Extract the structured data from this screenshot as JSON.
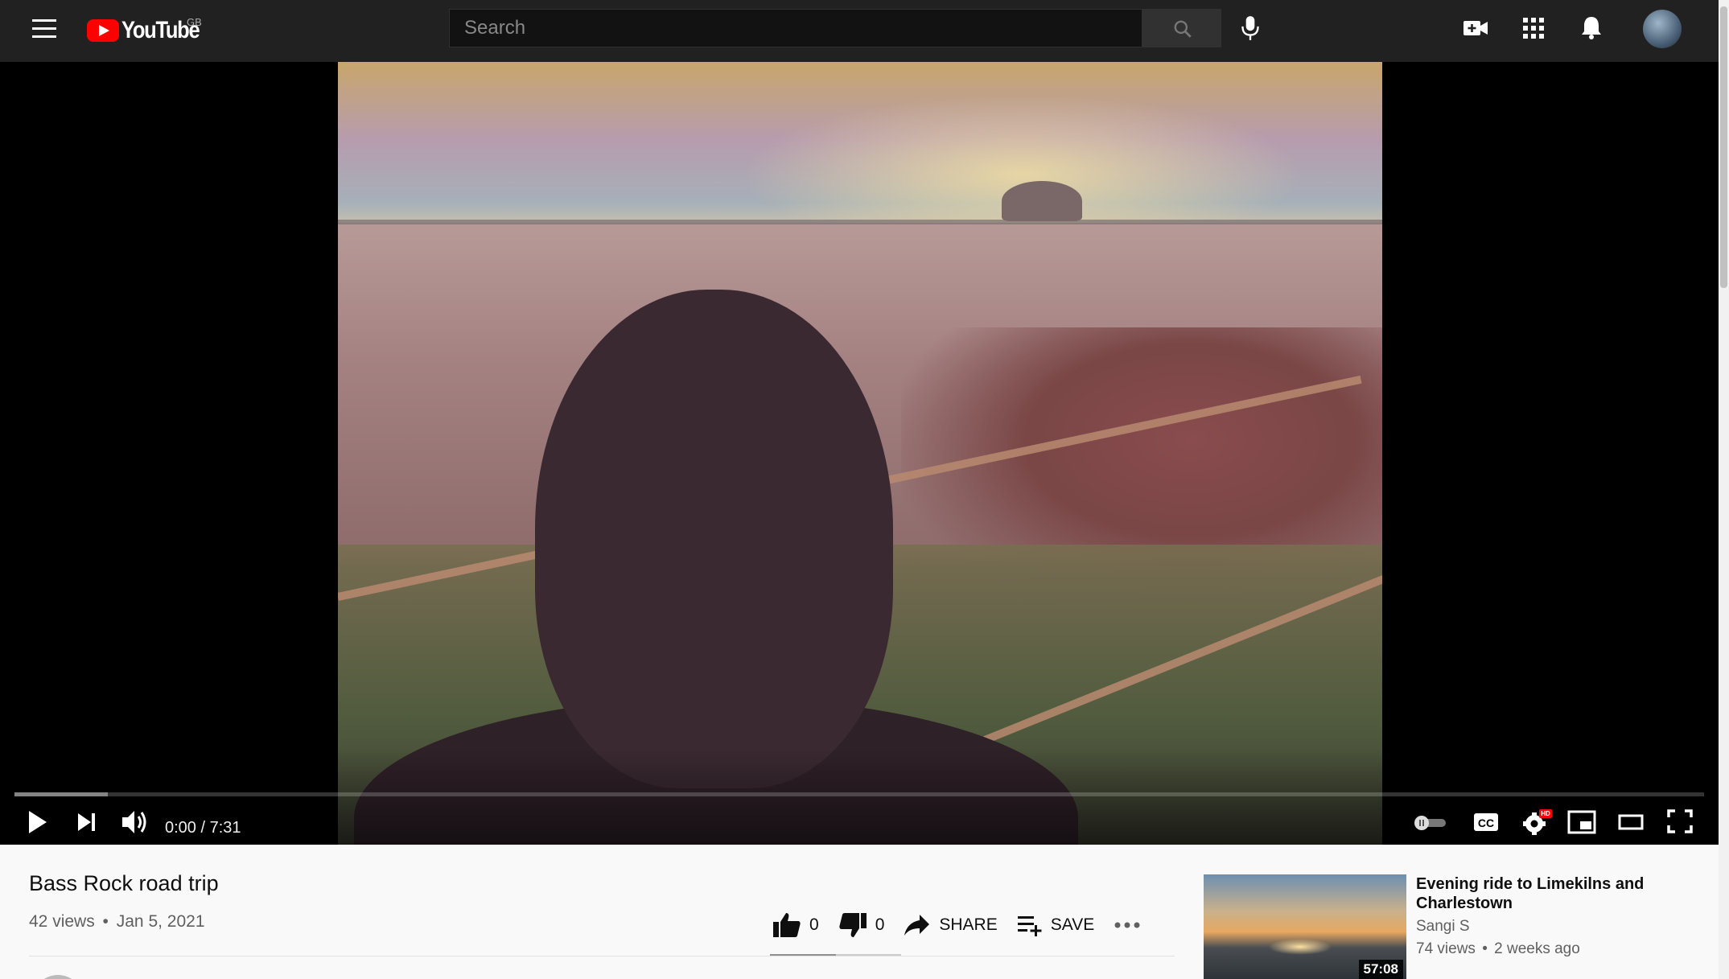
{
  "header": {
    "brand": "YouTube",
    "region": "GB",
    "search_placeholder": "Search",
    "icons": [
      "menu-icon",
      "search-icon",
      "microphone-icon",
      "create-video-icon",
      "apps-icon",
      "notifications-icon",
      "avatar"
    ]
  },
  "player": {
    "time_current": "0:00",
    "time_separator": " / ",
    "time_total": "7:31",
    "progress_loaded_fraction": 0.055,
    "hd_badge": "HD"
  },
  "video": {
    "title": "Bass Rock road trip",
    "views": "42 views",
    "date": "Jan 5, 2021",
    "separator": "•",
    "likes": "0",
    "dislikes": "0",
    "share_label": "SHARE",
    "save_label": "SAVE"
  },
  "recommendation": {
    "title": "Evening ride to Limekilns and Charlestown",
    "channel": "Sangi S",
    "views": "74 views",
    "age": "2 weeks ago",
    "duration": "57:08"
  },
  "colors": {
    "header_bg": "#212121",
    "logo_red": "#ff0000",
    "page_bg": "#f9f9f9"
  }
}
